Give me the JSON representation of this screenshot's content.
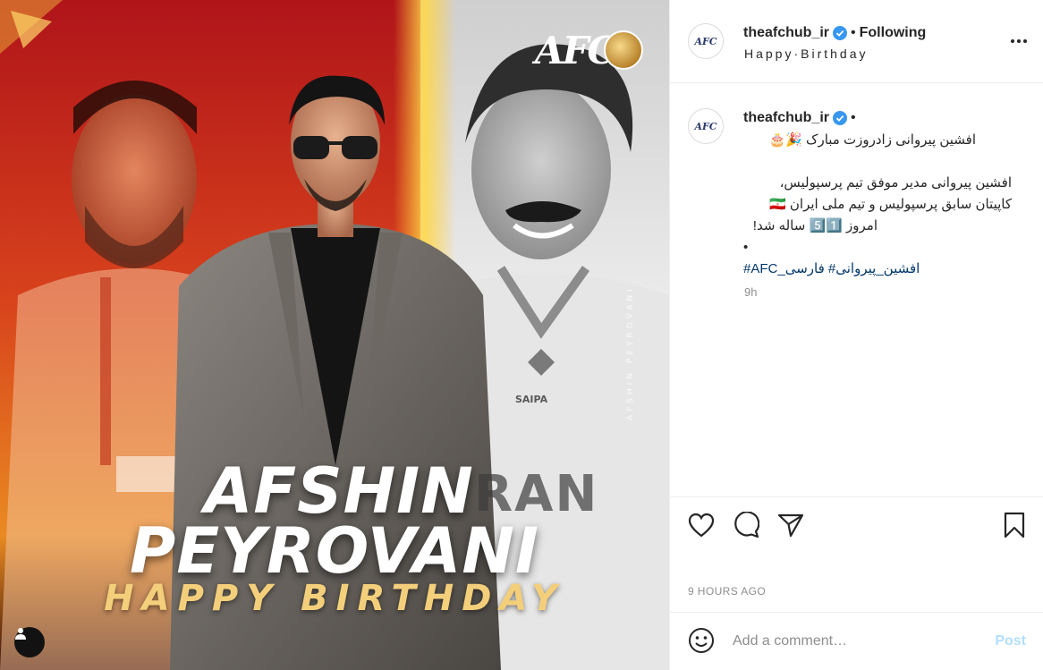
{
  "post_image": {
    "first_name": "AFSHIN",
    "last_name": "PEYROVANI",
    "subtitle": "HAPPY BIRTHDAY",
    "logo_text": "AFC",
    "vertical_name": "AFSHIN PEYROVANI",
    "jersey_text": "RAN",
    "jersey_sponsor": "SAIPA"
  },
  "header": {
    "username": "theafchub_ir",
    "separator": "•",
    "follow_label": "Following",
    "location": "Happy·Birthday"
  },
  "caption": {
    "username": "theafchub_ir",
    "separator": "•",
    "line1": "افشین پیروانی زادروزت مبارک 🎉🎂",
    "line2": "افشین پیروانی مدیر موفق تیم پرسپولیس،",
    "line3": "کاپیتان سابق پرسپولیس و تیم ملی ایران 🇮🇷",
    "line4": "امروز 5️⃣1️⃣ ساله شد!",
    "line5": "•",
    "hashtags": "#AFC_افشین_پیروانی# فارسی",
    "time_ago": "9h"
  },
  "actions": {
    "posted_time": "9 HOURS AGO"
  },
  "comment": {
    "placeholder": "Add a comment…",
    "post_label": "Post"
  },
  "colors": {
    "link": "#00376b",
    "verified": "#3897f0",
    "post_disabled": "#b2dffc",
    "muted": "#8e8e8e"
  }
}
